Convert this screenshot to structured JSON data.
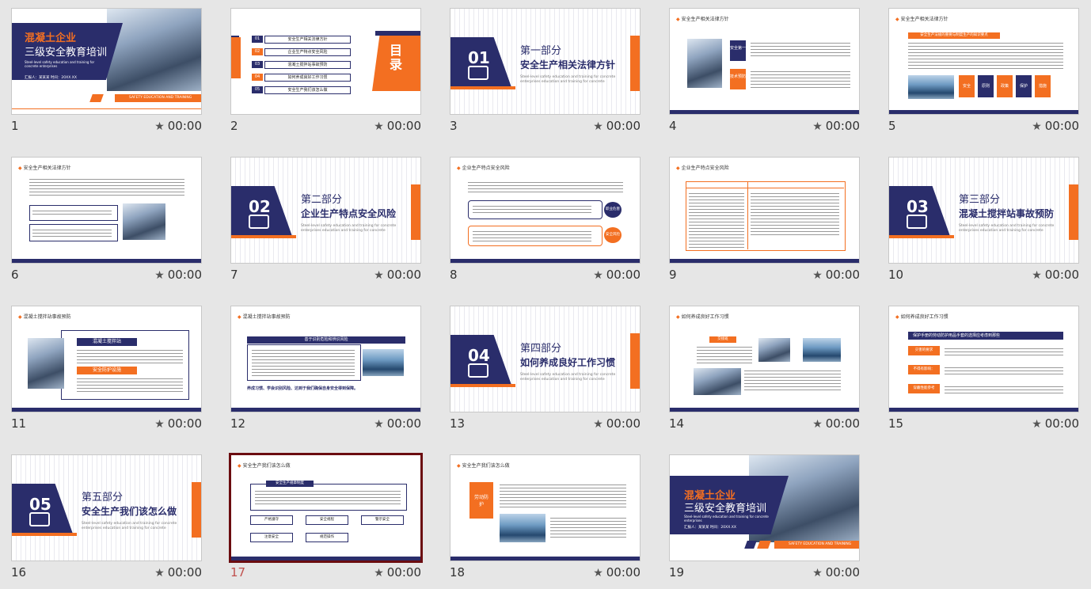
{
  "slides": [
    {
      "num": "1",
      "time": "00:00",
      "title1": "混凝土企业",
      "title2": "三级安全教育培训",
      "sub": "Steel-level safety education and training for concrete enterprises",
      "meta": "汇报人：某某某  时间：20XX.XX",
      "footer": "SAFETY EDUCATION AND TRAINING"
    },
    {
      "num": "2",
      "time": "00:00",
      "toc_title": "目录",
      "toc": [
        {
          "n": "01",
          "t": "安全生产相关法律方针"
        },
        {
          "n": "02",
          "t": "企业生产特点安全风险"
        },
        {
          "n": "03",
          "t": "混凝土搅拌站事故预防"
        },
        {
          "n": "04",
          "t": "如何养成良好工作习惯"
        },
        {
          "n": "05",
          "t": "安全生产我们该怎么做"
        }
      ]
    },
    {
      "num": "3",
      "time": "00:00",
      "sec": "01",
      "part": "第一部分",
      "name": "安全生产相关法律方针",
      "en": "Steel-level safety education and training for concrete enterprises education and training for concrete"
    },
    {
      "num": "4",
      "time": "00:00",
      "hdr": "安全生产相关法律方针",
      "labels": [
        "安全第一",
        "技术预防"
      ]
    },
    {
      "num": "5",
      "time": "00:00",
      "hdr": "安全生产相关法律方针",
      "banner": "安全生产法规的重要与制度生产的知识要点",
      "keys": [
        "安全",
        "原则",
        "政策",
        "保护",
        "措施"
      ]
    },
    {
      "num": "6",
      "time": "00:00",
      "hdr": "安全生产相关法律方针"
    },
    {
      "num": "7",
      "time": "00:00",
      "sec": "02",
      "part": "第二部分",
      "name": "企业生产特点安全风险",
      "en": "Steel-level safety education and training for concrete enterprises education and training for concrete"
    },
    {
      "num": "8",
      "time": "00:00",
      "hdr": "企业生产特点安全风险",
      "b1": "职业危害",
      "b2": "安全风险"
    },
    {
      "num": "9",
      "time": "00:00",
      "hdr": "企业生产特点安全风险"
    },
    {
      "num": "10",
      "time": "00:00",
      "sec": "03",
      "part": "第三部分",
      "name": "混凝土搅拌站事故预防",
      "en": "Steel-level safety education and training for concrete enterprises education and training for concrete"
    },
    {
      "num": "11",
      "time": "00:00",
      "hdr": "混凝土搅拌站事故预防",
      "l1": "混凝土搅拌站",
      "l2": "安全防护设施"
    },
    {
      "num": "12",
      "time": "00:00",
      "hdr": "混凝土搅拌站事故预防",
      "banner": "善于识别危险和辨识风险",
      "note": "养成习惯、学会识别风险、达到于我们确保自身安全得到保障。"
    },
    {
      "num": "13",
      "time": "00:00",
      "sec": "04",
      "part": "第四部分",
      "name": "如何养成良好工作习惯",
      "en": "Steel-level safety education and training for concrete enterprises education and training for concrete"
    },
    {
      "num": "14",
      "time": "00:00",
      "hdr": "如何养成良好工作习惯",
      "label": "交接班"
    },
    {
      "num": "15",
      "time": "00:00",
      "hdr": "如何养成良好工作习惯",
      "banner": "保护手册的劳动防护用品手套的选择应考虑到那些",
      "items": [
        "灾害的要求",
        "不得有影响：",
        "穿戴性能参考"
      ]
    },
    {
      "num": "16",
      "time": "00:00",
      "sec": "05",
      "part": "第五部分",
      "name": "安全生产我们该怎么做",
      "en": "Steel-level safety education and training for concrete enterprises education and training for concrete"
    },
    {
      "num": "17",
      "time": "00:00",
      "hdr": "安全生产我们该怎么做",
      "banner": "安全生产规章制度",
      "btns": [
        "严格遵守",
        "安全规程",
        "警示安全",
        "注意安全",
        "规范操作"
      ]
    },
    {
      "num": "18",
      "time": "00:00",
      "hdr": "安全生产我们该怎么做",
      "label": "劳动防护"
    },
    {
      "num": "19",
      "time": "00:00",
      "title1": "混凝土企业",
      "title2": "三级安全教育培训",
      "sub": "Steel-level safety education and training for concrete enterprises",
      "meta": "汇报人：某某某  时间：20XX.XX",
      "footer": "SAFETY EDUCATION AND TRAINING"
    }
  ],
  "colors": {
    "navy": "#2a2d6b",
    "orange": "#f36f21",
    "selected_border": "#6b0c10"
  },
  "selected_slide": "17",
  "icons": {
    "timing": "star-icon"
  }
}
